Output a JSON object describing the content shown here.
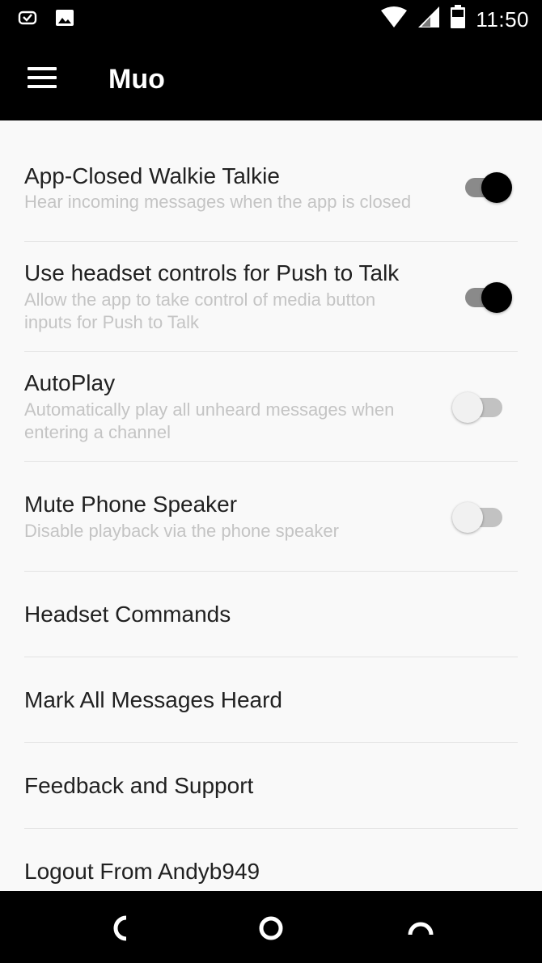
{
  "status_bar": {
    "time": "11:50",
    "left_icons": [
      "mail-check-icon",
      "image-icon"
    ],
    "right_icons": [
      "wifi-icon",
      "cell-signal-icon",
      "battery-icon"
    ]
  },
  "app_bar": {
    "title": "Muo",
    "menu_icon": "hamburger-menu-icon"
  },
  "settings": [
    {
      "title": "App-Closed Walkie Talkie",
      "subtitle": "Hear incoming messages when the app is closed",
      "toggle": "on"
    },
    {
      "title": "Use headset controls for Push to Talk",
      "subtitle_lines": [
        "Allow the app to take control of media button",
        "inputs for Push to Talk"
      ],
      "toggle": "on"
    },
    {
      "title": "AutoPlay",
      "subtitle_lines": [
        "Automatically play all unheard messages when",
        "entering a channel"
      ],
      "toggle": "off"
    },
    {
      "title": "Mute Phone Speaker",
      "subtitle": "Disable playback via the phone speaker",
      "toggle": "off"
    },
    {
      "title": "Headset Commands"
    },
    {
      "title": "Mark All Messages Heard"
    },
    {
      "title": "Feedback and Support"
    },
    {
      "title": "Logout From Andyb949"
    }
  ],
  "nav_bar": {
    "icons": [
      "back-icon",
      "home-icon",
      "recents-icon"
    ]
  },
  "colors": {
    "bar_background": "#000000",
    "page_background": "#f9f9f9",
    "title_text": "#212121",
    "subtitle_text": "#c4c4c4",
    "divider": "#e3e3e3"
  }
}
